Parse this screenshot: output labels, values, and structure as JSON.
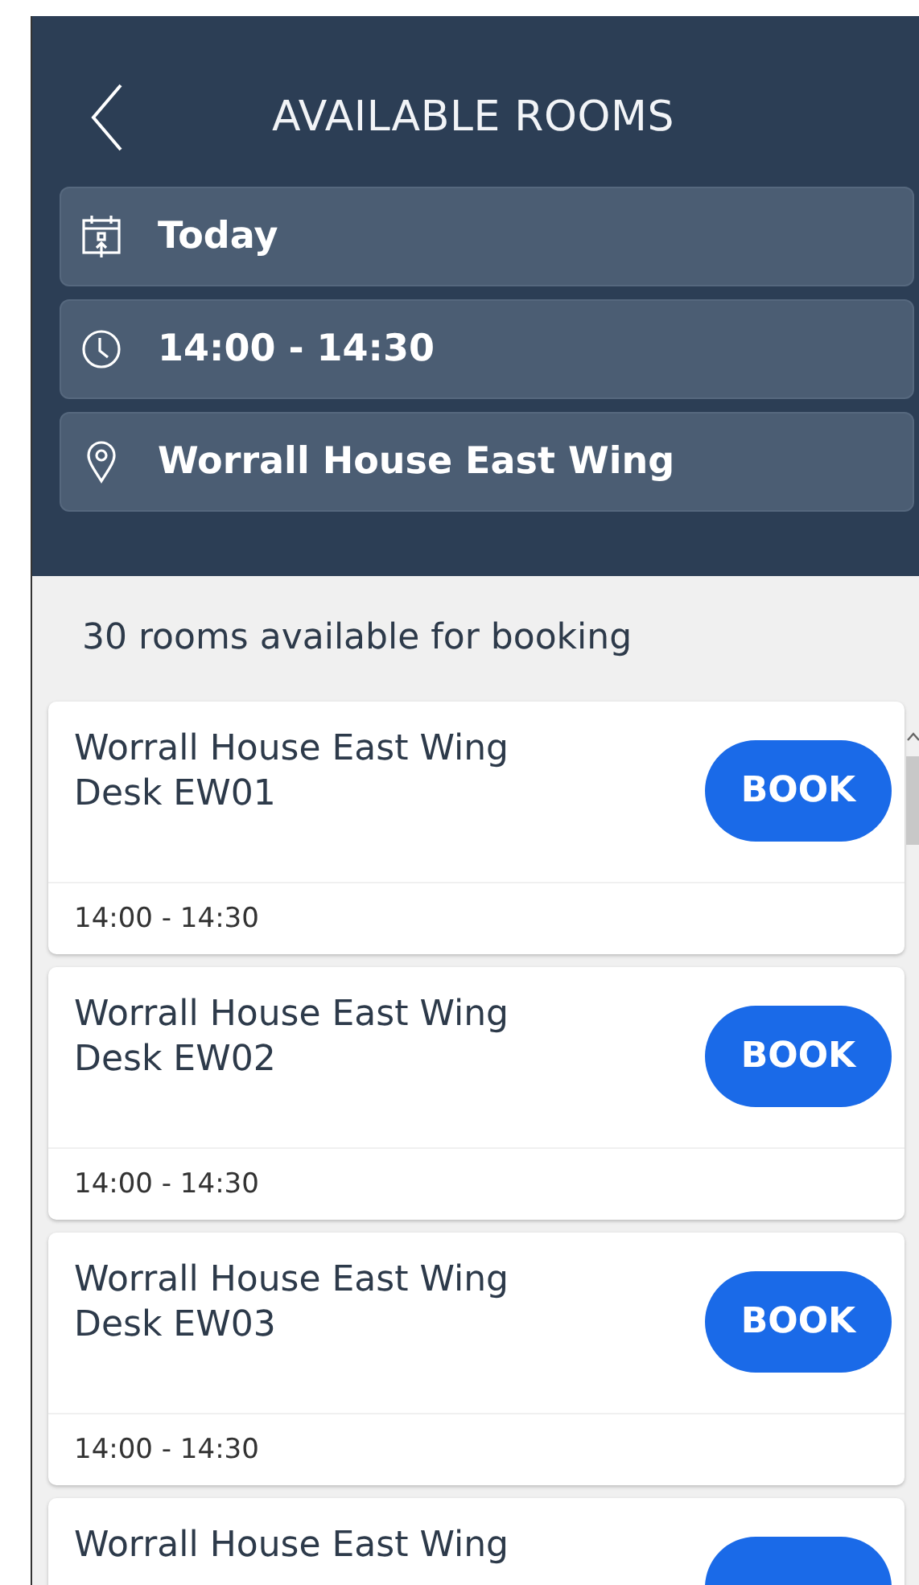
{
  "header": {
    "title": "AVAILABLE ROOMS"
  },
  "filters": [
    {
      "kind": "date",
      "label": "Today"
    },
    {
      "kind": "time",
      "label": "14:00 - 14:30"
    },
    {
      "kind": "location",
      "label": "Worrall House East Wing"
    }
  ],
  "summary": "30 rooms available for booking",
  "rooms": [
    {
      "name": "Worrall House East Wing Desk EW01",
      "action": "BOOK",
      "time": "14:00 - 14:30"
    },
    {
      "name": "Worrall House East Wing Desk EW02",
      "action": "BOOK",
      "time": "14:00 - 14:30"
    },
    {
      "name": "Worrall House East Wing Desk EW03",
      "action": "BOOK",
      "time": "14:00 - 14:30"
    },
    {
      "name": "Worrall House East Wing"
    }
  ]
}
